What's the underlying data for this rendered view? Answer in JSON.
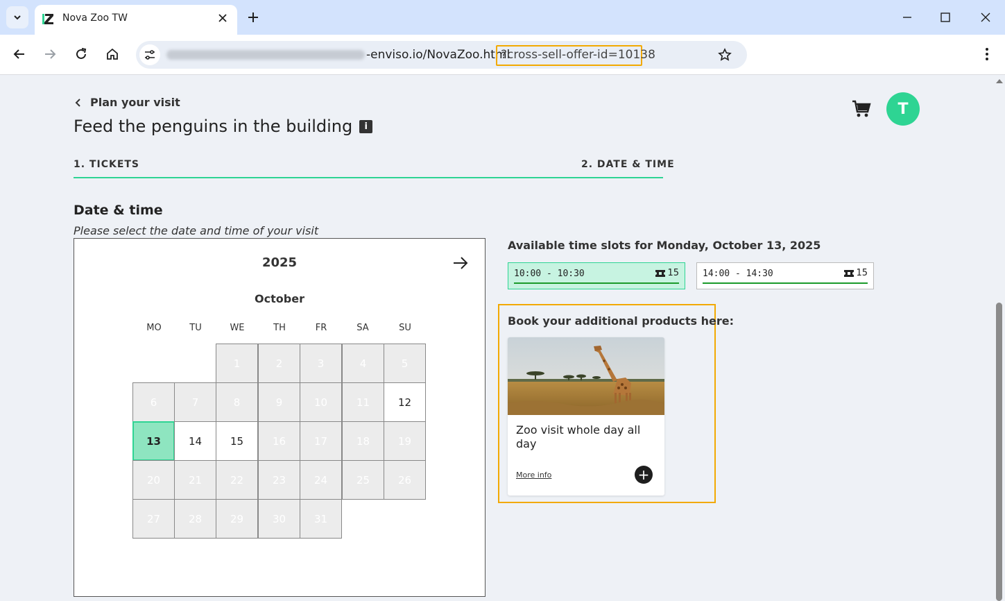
{
  "browser": {
    "tab_title": "Nova Zoo TW",
    "url_domain_visible": "-enviso.io/NovaZoo.html",
    "url_param": "?cross-sell-offer-id=10138"
  },
  "page": {
    "back_label": "Plan your visit",
    "title": "Feed the penguins in the building",
    "info_icon": "i",
    "avatar_initial": "T"
  },
  "steps": [
    {
      "label": "1. TICKETS"
    },
    {
      "label": "2. DATE & TIME"
    }
  ],
  "date_section": {
    "title": "Date & time",
    "subtitle": "Please select the date and time of your visit"
  },
  "calendar": {
    "year": "2025",
    "month": "October",
    "weekdays": [
      "MO",
      "TU",
      "WE",
      "TH",
      "FR",
      "SA",
      "SU"
    ],
    "selected_day": "13",
    "available_days": [
      "12",
      "14",
      "15"
    ],
    "days": [
      "1",
      "2",
      "3",
      "4",
      "5",
      "6",
      "7",
      "8",
      "9",
      "10",
      "11",
      "12",
      "13",
      "14",
      "15",
      "16",
      "17",
      "18",
      "19",
      "20",
      "21",
      "22",
      "23",
      "24",
      "25",
      "26",
      "27",
      "28",
      "29",
      "30",
      "31"
    ]
  },
  "slots": {
    "title": "Available time slots for Monday, October 13, 2025",
    "items": [
      {
        "time": "10:00 - 10:30",
        "capacity": "15"
      },
      {
        "time": "14:00 - 14:30",
        "capacity": "15"
      }
    ]
  },
  "cross_sell": {
    "title": "Book your additional products here:",
    "product_name": "Zoo visit whole day all day",
    "more_info": "More info",
    "add_symbol": "+"
  },
  "colors": {
    "accent": "#2ed493",
    "highlight": "#f2a900",
    "slot_bar": "#1a9a2a"
  }
}
